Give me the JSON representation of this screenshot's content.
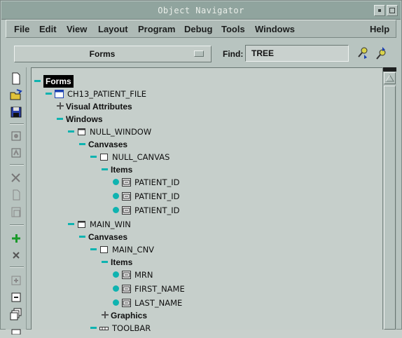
{
  "window": {
    "title": "Object Navigator"
  },
  "menubar": {
    "items": [
      "File",
      "Edit",
      "View",
      "Layout",
      "Program",
      "Debug",
      "Tools",
      "Windows",
      "Help"
    ]
  },
  "toolbar": {
    "context_value": "Forms",
    "find_label": "Find:",
    "find_value": "TREE"
  },
  "tree": {
    "nodes": [
      {
        "label": "Forms",
        "depth": 0,
        "node": "expanded",
        "kind": "root",
        "selected": true
      },
      {
        "label": "CH13_PATIENT_FILE",
        "depth": 1,
        "node": "expanded",
        "kind": "form-module"
      },
      {
        "label": "Visual Attributes",
        "depth": 2,
        "node": "collapsed",
        "kind": "category"
      },
      {
        "label": "Windows",
        "depth": 2,
        "node": "expanded",
        "kind": "category"
      },
      {
        "label": "NULL_WINDOW",
        "depth": 3,
        "node": "expanded",
        "kind": "window"
      },
      {
        "label": "Canvases",
        "depth": 4,
        "node": "expanded",
        "kind": "category"
      },
      {
        "label": "NULL_CANVAS",
        "depth": 5,
        "node": "expanded",
        "kind": "canvas"
      },
      {
        "label": "Items",
        "depth": 6,
        "node": "expanded",
        "kind": "category"
      },
      {
        "label": "PATIENT_ID",
        "depth": 7,
        "node": "leaf",
        "kind": "item"
      },
      {
        "label": "PATIENT_ID",
        "depth": 7,
        "node": "leaf",
        "kind": "item"
      },
      {
        "label": "PATIENT_ID",
        "depth": 7,
        "node": "leaf",
        "kind": "item"
      },
      {
        "label": "MAIN_WIN",
        "depth": 3,
        "node": "expanded",
        "kind": "window"
      },
      {
        "label": "Canvases",
        "depth": 4,
        "node": "expanded",
        "kind": "category"
      },
      {
        "label": "MAIN_CNV",
        "depth": 5,
        "node": "expanded",
        "kind": "canvas"
      },
      {
        "label": "Items",
        "depth": 6,
        "node": "expanded",
        "kind": "category"
      },
      {
        "label": "MRN",
        "depth": 7,
        "node": "leaf",
        "kind": "item"
      },
      {
        "label": "FIRST_NAME",
        "depth": 7,
        "node": "leaf",
        "kind": "item"
      },
      {
        "label": "LAST_NAME",
        "depth": 7,
        "node": "leaf",
        "kind": "item"
      },
      {
        "label": "Graphics",
        "depth": 6,
        "node": "collapsed",
        "kind": "category"
      },
      {
        "label": "TOOLBAR",
        "depth": 5,
        "node": "expanded",
        "kind": "toolbar-canvas"
      }
    ]
  },
  "tools": [
    "new-icon",
    "open-icon",
    "save-icon",
    "run-form-icon",
    "debug-icon",
    "cut-icon",
    "copy-icon",
    "paste-icon",
    "create-icon",
    "delete-icon",
    "expand-icon",
    "collapse-icon",
    "expand-all-icon",
    "collapse-all-icon"
  ],
  "colors": {
    "node_marker": "#0fb3b0",
    "titlebar": "#90a49e",
    "pane": "#c6cfcb"
  }
}
